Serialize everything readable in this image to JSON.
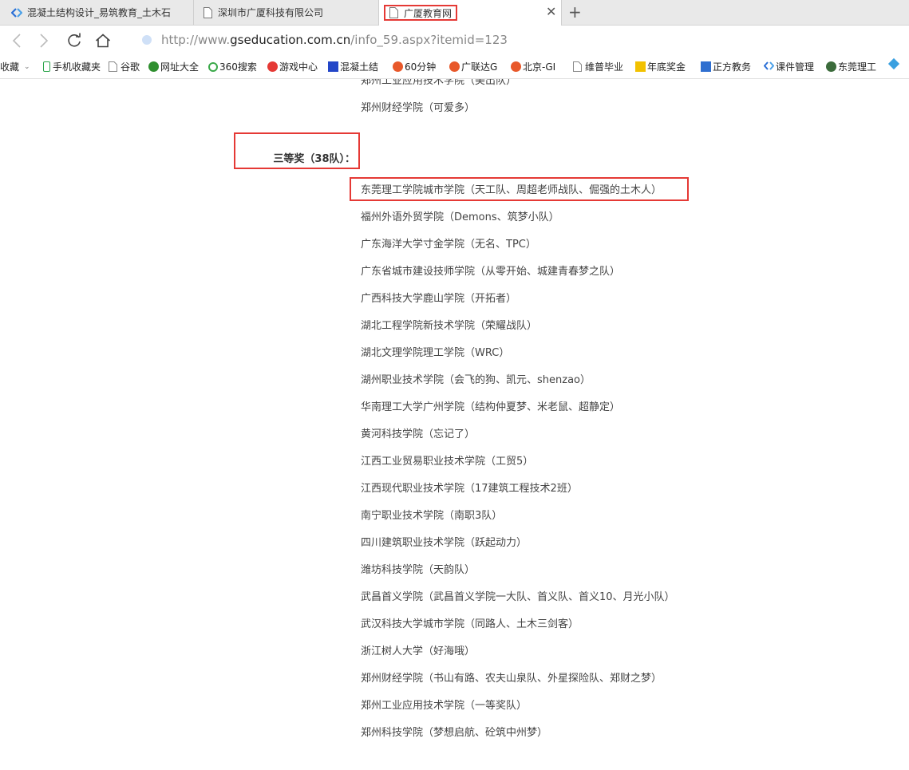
{
  "tabs": [
    {
      "title": "混凝土结构设计_易筑教育_土木石",
      "icon": "chevron-logo-icon"
    },
    {
      "title": "深圳市广厦科技有限公司",
      "icon": "page-icon"
    },
    {
      "title": "广厦教育网",
      "icon": "page-icon"
    }
  ],
  "address": {
    "prefix": "http://www.",
    "domain": "gseducation.com.cn",
    "path": "/info_59.aspx?itemid=123"
  },
  "bookmarks": [
    "收藏",
    "手机收藏夹",
    "谷歌",
    "网址大全",
    "360搜索",
    "游戏中心",
    "混凝土结",
    "60分钟",
    "广联达G",
    "北京-GI",
    "维普毕业",
    "年底奖金",
    "正方教务",
    "课件管理",
    "东莞理工"
  ],
  "content": {
    "prev_partial": "郑州工业应用技术学院（美出队）",
    "prev_item": "郑州财经学院（可爱多）",
    "award_label": "三等奖（38队）：",
    "items": [
      "东莞理工学院城市学院（天工队、周超老师战队、倔强的土木人）",
      "福州外语外贸学院（Demons、筑梦小队）",
      "广东海洋大学寸金学院（无名、TPC）",
      "广东省城市建设技师学院（从零开始、城建青春梦之队）",
      "广西科技大学鹿山学院（开拓者）",
      "湖北工程学院新技术学院（荣耀战队）",
      "湖北文理学院理工学院（WRC）",
      "湖州职业技术学院（会飞的狗、凯元、shenzao）",
      "华南理工大学广州学院（结构仲夏梦、米老鼠、超静定）",
      "黄河科技学院（忘记了）",
      "江西工业贸易职业技术学院（工贸5）",
      "江西现代职业技术学院（17建筑工程技术2班）",
      "南宁职业技术学院（南职3队）",
      "四川建筑职业技术学院（跃起动力）",
      "潍坊科技学院（天韵队）",
      "武昌首义学院（武昌首义学院一大队、首义队、首义10、月光小队）",
      "武汉科技大学城市学院（同路人、土木三剑客）",
      "浙江树人大学（好海哦）",
      "郑州财经学院（书山有路、农夫山泉队、外星探险队、郑财之梦）",
      "郑州工业应用技术学院（一等奖队）",
      "郑州科技学院（梦想启航、砼筑中州梦）"
    ]
  },
  "colors": {
    "highlight": "#e53935",
    "tabbar": "#e9e9e9"
  }
}
